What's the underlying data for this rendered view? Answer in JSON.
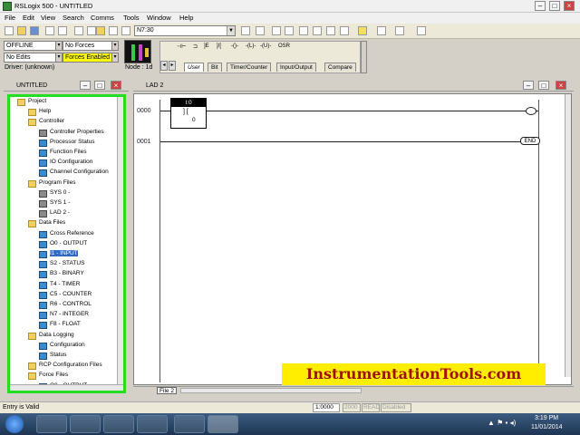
{
  "window": {
    "title": "RSLogix 500 - UNTITLED"
  },
  "menu": [
    "File",
    "Edit",
    "View",
    "Search",
    "Comms",
    "Tools",
    "Window",
    "Help"
  ],
  "toolbar": {
    "address_value": "N7:30"
  },
  "status_panel": {
    "mode": "OFFLINE",
    "forces": "No Forces",
    "edits": "No Edits",
    "forces_enabled": "Forces Enabled",
    "driver": "Driver: (unknown)",
    "node": "Node : 1d"
  },
  "instruction_tabs": [
    "User",
    "Bit",
    "Timer/Counter",
    "Input/Output",
    "Compare"
  ],
  "project_panel": {
    "title": "UNTITLED"
  },
  "tree": [
    {
      "label": "Project",
      "level": 0,
      "icon": "folder"
    },
    {
      "label": "Help",
      "level": 1,
      "icon": "folder"
    },
    {
      "label": "Controller",
      "level": 1,
      "icon": "folder"
    },
    {
      "label": "Controller Properties",
      "level": 2,
      "icon": "info"
    },
    {
      "label": "Processor Status",
      "level": 2,
      "icon": "file"
    },
    {
      "label": "Function Files",
      "level": 2,
      "icon": "file"
    },
    {
      "label": "IO Configuration",
      "level": 2,
      "icon": "file"
    },
    {
      "label": "Channel Configuration",
      "level": 2,
      "icon": "file"
    },
    {
      "label": "Program Files",
      "level": 1,
      "icon": "folder"
    },
    {
      "label": "SYS 0 -",
      "level": 2,
      "icon": "prog"
    },
    {
      "label": "SYS 1 -",
      "level": 2,
      "icon": "prog"
    },
    {
      "label": "LAD 2 -",
      "level": 2,
      "icon": "prog"
    },
    {
      "label": "Data Files",
      "level": 1,
      "icon": "folder"
    },
    {
      "label": "Cross Reference",
      "level": 2,
      "icon": "file"
    },
    {
      "label": "O0 - OUTPUT",
      "level": 2,
      "icon": "file"
    },
    {
      "label": "I1 - INPUT",
      "level": 2,
      "icon": "file",
      "selected": true
    },
    {
      "label": "S2 - STATUS",
      "level": 2,
      "icon": "file"
    },
    {
      "label": "B3 - BINARY",
      "level": 2,
      "icon": "file"
    },
    {
      "label": "T4 - TIMER",
      "level": 2,
      "icon": "file"
    },
    {
      "label": "C5 - COUNTER",
      "level": 2,
      "icon": "file"
    },
    {
      "label": "R6 - CONTROL",
      "level": 2,
      "icon": "file"
    },
    {
      "label": "N7 - INTEGER",
      "level": 2,
      "icon": "file"
    },
    {
      "label": "F8 - FLOAT",
      "level": 2,
      "icon": "file"
    },
    {
      "label": "Data Logging",
      "level": 1,
      "icon": "folder"
    },
    {
      "label": "Configuration",
      "level": 2,
      "icon": "file"
    },
    {
      "label": "Status",
      "level": 2,
      "icon": "file"
    },
    {
      "label": "RCP Configuration Files",
      "level": 1,
      "icon": "folder"
    },
    {
      "label": "Force Files",
      "level": 1,
      "icon": "folder"
    },
    {
      "label": "O0 - OUTPUT",
      "level": 2,
      "icon": "file"
    }
  ],
  "ladder": {
    "title": "LAD 2",
    "rungs": [
      "0000",
      "0001"
    ],
    "instruction_address": "I:0",
    "instruction_bit": "0",
    "end_label": "END",
    "file_tab": "File 2"
  },
  "watermark": "InstrumentationTools.com",
  "statusbar": {
    "message": "Entry is Valid",
    "position": "1:0000",
    "cell1": "2000",
    "cell2": "READ",
    "cell3": "Disabled"
  },
  "taskbar": {
    "time": "3:19 PM",
    "date": "11/01/2014"
  },
  "colors": {
    "highlight_border": "#22dd22",
    "watermark_bg": "#ffee00",
    "watermark_text": "#a01010"
  }
}
